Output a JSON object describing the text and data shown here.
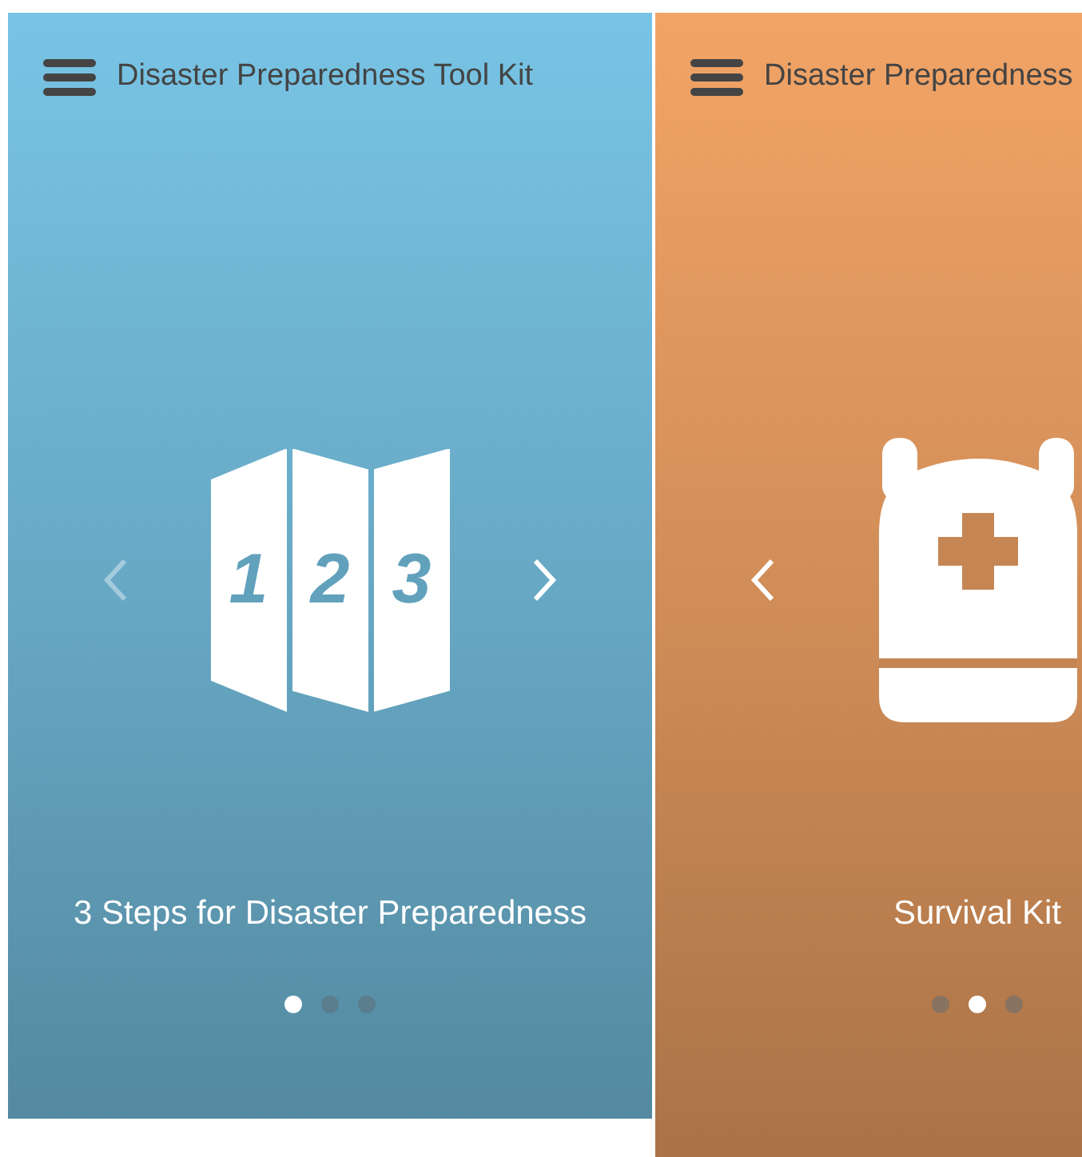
{
  "screens": [
    {
      "title": "Disaster Preparedness Tool Kit",
      "color": "#78c4e5",
      "slide": {
        "kind": "steps",
        "caption": "3 Steps for Disaster Preparedness",
        "step_numbers": [
          "1",
          "2",
          "3"
        ]
      },
      "arrows": [
        {
          "kind": "prev",
          "disabled": true
        },
        {
          "kind": "next",
          "disabled": false
        }
      ],
      "dots": [
        {
          "selected": true
        },
        {
          "selected": false
        },
        {
          "selected": false
        }
      ]
    },
    {
      "title": "Disaster Preparedness",
      "color": "#f2a466",
      "slide": {
        "kind": "backpack",
        "caption": "Survival Kit"
      },
      "arrows": [
        {
          "kind": "prev",
          "disabled": false
        }
      ],
      "dots": [
        {
          "selected": false
        },
        {
          "selected": true
        },
        {
          "selected": false
        }
      ]
    }
  ]
}
